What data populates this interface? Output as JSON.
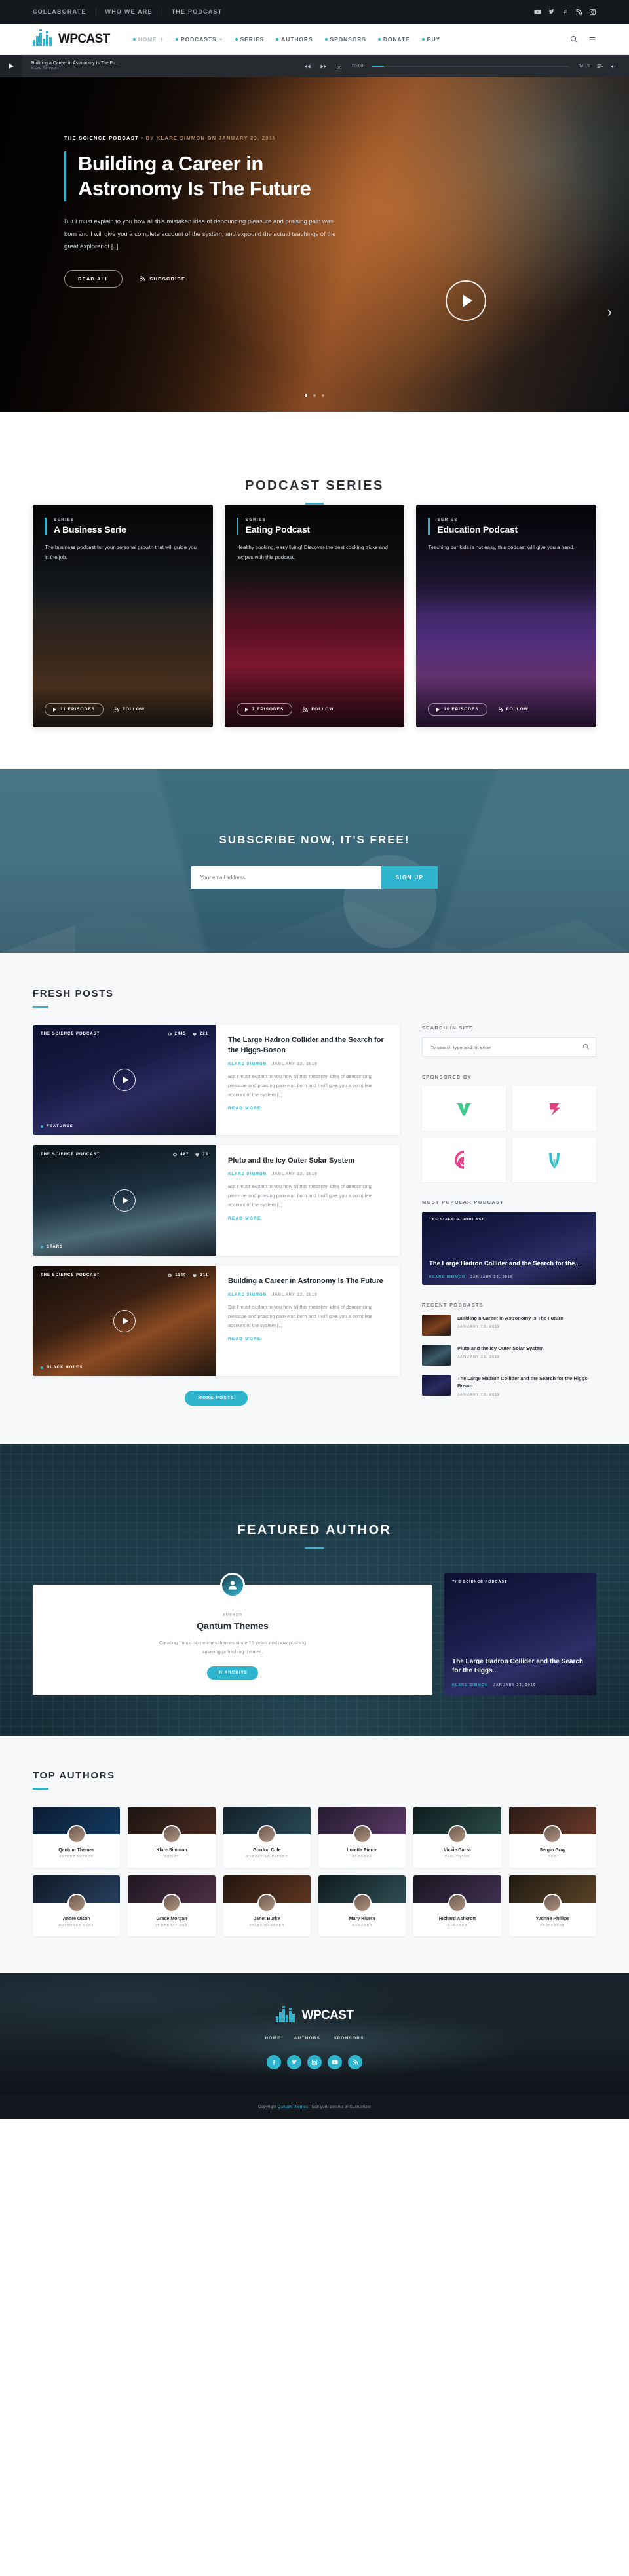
{
  "topbar": {
    "links": [
      "COLLABORATE",
      "WHO WE ARE",
      "THE PODCAST"
    ],
    "social": [
      "youtube-icon",
      "twitter-icon",
      "facebook-icon",
      "rss-icon",
      "instagram-icon"
    ]
  },
  "header": {
    "logo_wp": "WP",
    "logo_cast": "CAST",
    "nav": [
      {
        "label": "HOME",
        "plus": "+",
        "active": true
      },
      {
        "label": "PODCASTS",
        "plus": "+",
        "active": false
      },
      {
        "label": "SERIES",
        "plus": "",
        "active": false
      },
      {
        "label": "AUTHORS",
        "plus": "",
        "active": false
      },
      {
        "label": "SPONSORS",
        "plus": "",
        "active": false
      },
      {
        "label": "DONATE",
        "plus": "",
        "active": false
      },
      {
        "label": "BUY",
        "plus": "",
        "active": false
      }
    ],
    "icons": [
      "search-icon",
      "menu-icon"
    ]
  },
  "player": {
    "now_playing": "Building a Career in Astronomy Is The Fu...",
    "author": "Klare Simmon",
    "time_current": "00:00",
    "time_total": "34:19"
  },
  "hero": {
    "category": "THE SCIENCE PODCAST",
    "separator": "•",
    "byline": "BY KLARE SIMMON ON JANUARY 23, 2019",
    "title": "Building a Career in Astronomy Is The Future",
    "description": "But I must explain to you how all this mistaken idea of denouncing pleasure and praising pain was born and I will give you a complete account of the system, and expound the actual teachings of the great explorer of [..]",
    "read_all": "READ ALL",
    "subscribe": "SUBSCRIBE",
    "slide_count": 3,
    "active_slide": 1
  },
  "series_section": {
    "title": "PODCAST SERIES",
    "cards": [
      {
        "label": "SERIES",
        "title": "A Business Serie",
        "desc": "The business podcast for your personal growth that will guide you in the job.",
        "episodes": "11 EPISODES",
        "follow": "FOLLOW"
      },
      {
        "label": "SERIES",
        "title": "Eating Podcast",
        "desc": "Healthy cooking, easy living! Discover the best cooking tricks and recipes with this podcast.",
        "episodes": "7 EPISODES",
        "follow": "FOLLOW"
      },
      {
        "label": "SERIES",
        "title": "Education Podcast",
        "desc": "Teaching our kids is not easy, this podcast will give you a hand.",
        "episodes": "10 EPISODES",
        "follow": "FOLLOW"
      }
    ]
  },
  "subscribe_section": {
    "title": "SUBSCRIBE NOW, IT'S FREE!",
    "placeholder": "Your email address",
    "button": "SIGN UP"
  },
  "fresh": {
    "title": "FRESH POSTS",
    "posts": [
      {
        "category": "THE SCIENCE PODCAST",
        "views": "2445",
        "likes": "221",
        "tag": "FEATURES",
        "title": "The Large Hadron Collider and the Search for the Higgs-Boson",
        "author": "KLARE SIMMON",
        "date": "JANUARY 23, 2019",
        "excerpt": "But I must explain to you how all this mistaken idea of denouncing pleasure and praising pain was born and I will give you a complete account of the system [..]",
        "read_more": "READ MORE"
      },
      {
        "category": "THE SCIENCE PODCAST",
        "views": "487",
        "likes": "73",
        "tag": "STARS",
        "title": "Pluto and the Icy Outer Solar System",
        "author": "KLARE SIMMON",
        "date": "JANUARY 23, 2019",
        "excerpt": "But I must explain to you how all this mistaken idea of denouncing pleasure and praising pain was born and I will give you a complete account of the system [..]",
        "read_more": "READ MORE"
      },
      {
        "category": "THE SCIENCE PODCAST",
        "views": "1149",
        "likes": "311",
        "tag": "BLACK HOLES",
        "title": "Building a Career in Astronomy Is The Future",
        "author": "KLARE SIMMON",
        "date": "JANUARY 23, 2019",
        "excerpt": "But I must explain to you how all this mistaken idea of denouncing pleasure and praising pain was born and I will give you a complete account of the system [..]",
        "read_more": "READ MORE"
      }
    ],
    "more_posts": "MORE POSTS"
  },
  "sidebar": {
    "search_title": "SEARCH IN SITE",
    "search_placeholder": "To search type and hit enter",
    "sponsors_title": "SPONSORED BY",
    "sponsors": [
      "sponsor-logo-green-v",
      "sponsor-logo-pink-s",
      "sponsor-logo-magenta-spiral",
      "sponsor-logo-teal-leaf"
    ],
    "popular_title": "MOST POPULAR PODCAST",
    "popular": {
      "category": "THE SCIENCE PODCAST",
      "title": "The Large Hadron Collider and the Search for the...",
      "author": "KLARE SIMMON",
      "date": "JANUARY 23, 2019"
    },
    "recent_title": "RECENT PODCASTS",
    "recent": [
      {
        "title": "Building a Career in Astronomy Is The Future",
        "date": "JANUARY 23, 2019"
      },
      {
        "title": "Pluto and the Icy Outer Solar System",
        "date": "JANUARY 23, 2019"
      },
      {
        "title": "The Large Hadron Collider and the Search for the Higgs-Boson",
        "date": "JANUARY 23, 2019"
      }
    ]
  },
  "featured_author": {
    "title": "FEATURED AUTHOR",
    "role": "AUTHOR",
    "name": "Qantum Themes",
    "bio": "Creating music sometimes themes since 15 years and now pushing amazing publishing themes.",
    "button": "IN ARCHIVE",
    "post": {
      "category": "THE SCIENCE PODCAST",
      "title": "The Large Hadron Collider and the Search for the Higgs...",
      "author": "KLARE SIMMON",
      "date": "JANUARY 23, 2019"
    }
  },
  "top_authors": {
    "title": "TOP AUTHORS",
    "authors": [
      {
        "name": "Qantum Themes",
        "role": "EXPERT AUTHOR"
      },
      {
        "name": "Klare Simmon",
        "role": "ARTIST"
      },
      {
        "name": "Gordon Cole",
        "role": "MARKETING EXPERT"
      },
      {
        "name": "Loretta Pierce",
        "role": "BLOGGER"
      },
      {
        "name": "Vickie Garza",
        "role": "SEO, TUTOR"
      },
      {
        "name": "Sergio Gray",
        "role": "SEO"
      },
      {
        "name": "Andre Olson",
        "role": "CUSTOMER CARE"
      },
      {
        "name": "Grace Morgan",
        "role": "IT OPERATIONS"
      },
      {
        "name": "Janet Burke",
        "role": "SALES MANAGER"
      },
      {
        "name": "Mary Rivera",
        "role": "MANAGER"
      },
      {
        "name": "Richard Ashcroft",
        "role": "MANAGER"
      },
      {
        "name": "Yvonne Phillips",
        "role": "PROFESSOR"
      }
    ]
  },
  "footer": {
    "logo_wp": "WP",
    "logo_cast": "CAST",
    "nav": [
      "HOME",
      "AUTHORS",
      "SPONSORS"
    ],
    "social": [
      "facebook-icon",
      "twitter-icon",
      "instagram-icon",
      "youtube-icon",
      "rss-icon"
    ],
    "copyright_prefix": "Copyright ",
    "copyright_link1": "QantumThemes",
    "copyright_mid": " - Edit your content in Customizer",
    "accent": "#2fb4cd"
  }
}
